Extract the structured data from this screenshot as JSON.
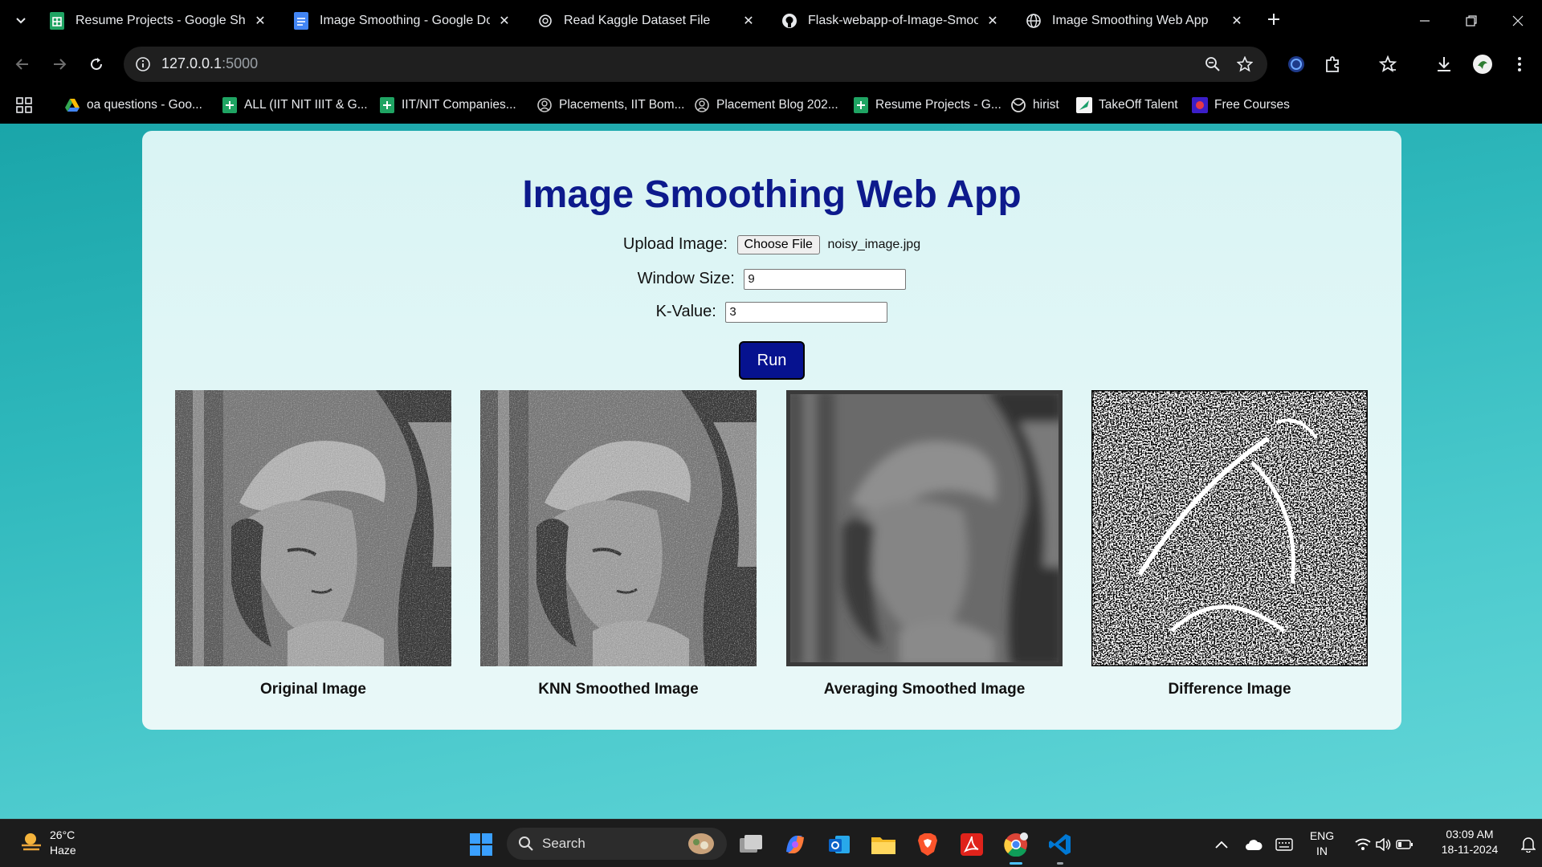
{
  "browser": {
    "tabs": [
      {
        "title": "Resume Projects - Google Shee",
        "icon": "google-sheets-icon"
      },
      {
        "title": "Image Smoothing - Google Doc",
        "icon": "google-docs-icon"
      },
      {
        "title": "Read Kaggle Dataset File",
        "icon": "chatgpt-icon"
      },
      {
        "title": "Flask-webapp-of-Image-Smoot",
        "icon": "github-icon"
      },
      {
        "title": "Image Smoothing Web App",
        "icon": "globe-icon",
        "active": true
      }
    ],
    "url_host": "127.0.0.1",
    "url_port": ":5000",
    "bookmarks": [
      "oa questions - Goo...",
      "ALL (IIT NIT IIIT & G...",
      "IIT/NIT Companies...",
      "Placements, IIT Bom...",
      "Placement Blog 202...",
      "Resume Projects - G...",
      "hirist",
      "TakeOff Talent",
      "Free Courses"
    ]
  },
  "page": {
    "title": "Image Smoothing Web App",
    "upload_label": "Upload Image:",
    "choose_file_label": "Choose File",
    "file_name": "noisy_image.jpg",
    "window_size_label": "Window Size:",
    "window_size_value": "9",
    "k_value_label": "K-Value:",
    "k_value_value": "3",
    "run_label": "Run",
    "results": [
      {
        "caption": "Original Image"
      },
      {
        "caption": "KNN Smoothed Image"
      },
      {
        "caption": "Averaging Smoothed Image"
      },
      {
        "caption": "Difference Image"
      }
    ]
  },
  "taskbar": {
    "temperature": "26°C",
    "weather": "Haze",
    "search_label": "Search",
    "lang_top": "ENG",
    "lang_bottom": "IN",
    "time": "03:09 AM",
    "date": "18-11-2024"
  },
  "colors": {
    "title": "#0d1a8c",
    "run_button": "#06128f",
    "background_teal": "#2fb8bc",
    "card": "#e4f7f7"
  }
}
